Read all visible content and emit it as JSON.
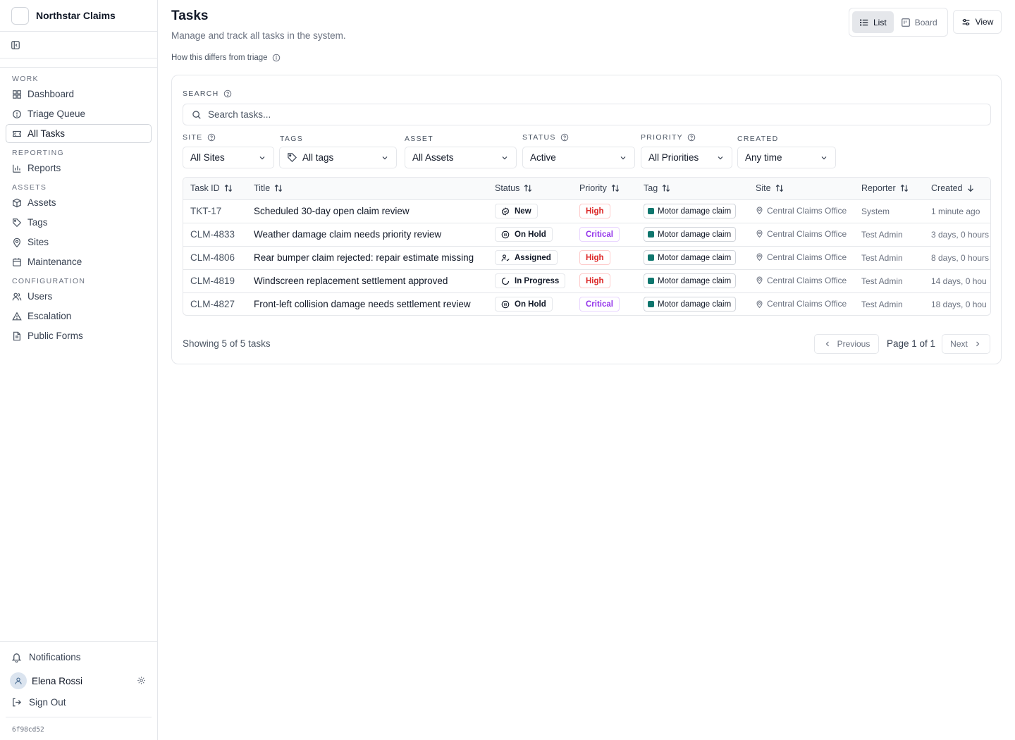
{
  "app": {
    "name": "Northstar Claims",
    "build": "6f98cd52"
  },
  "sidebar": {
    "sections": [
      {
        "label": "WORK",
        "items": [
          {
            "label": "Dashboard",
            "icon": "dashboard-icon"
          },
          {
            "label": "Triage Queue",
            "icon": "alert-circle-icon"
          },
          {
            "label": "All Tasks",
            "icon": "ticket-icon",
            "active": true
          }
        ]
      },
      {
        "label": "REPORTING",
        "items": [
          {
            "label": "Reports",
            "icon": "bar-chart-icon"
          }
        ]
      },
      {
        "label": "ASSETS",
        "items": [
          {
            "label": "Assets",
            "icon": "box-icon"
          },
          {
            "label": "Tags",
            "icon": "tag-icon"
          },
          {
            "label": "Sites",
            "icon": "map-pin-icon"
          },
          {
            "label": "Maintenance",
            "icon": "calendar-icon"
          }
        ]
      },
      {
        "label": "CONFIGURATION",
        "items": [
          {
            "label": "Users",
            "icon": "users-icon"
          },
          {
            "label": "Escalation",
            "icon": "warning-triangle-icon"
          },
          {
            "label": "Public Forms",
            "icon": "file-text-icon"
          }
        ]
      }
    ],
    "notifications_label": "Notifications",
    "user_name": "Elena Rossi",
    "sign_out_label": "Sign Out"
  },
  "header": {
    "title": "Tasks",
    "subtitle": "Manage and track all tasks in the system.",
    "help_link": "How this differs from triage",
    "view_list": "List",
    "view_board": "Board",
    "view_button": "View"
  },
  "filters": {
    "search_label": "SEARCH",
    "search_placeholder": "Search tasks...",
    "site_label": "SITE",
    "site_value": "All Sites",
    "tags_label": "TAGS",
    "tags_value": "All tags",
    "asset_label": "ASSET",
    "asset_value": "All Assets",
    "status_label": "STATUS",
    "status_value": "Active",
    "priority_label": "PRIORITY",
    "priority_value": "All Priorities",
    "created_label": "CREATED",
    "created_value": "Any time"
  },
  "table": {
    "columns": [
      "Task ID",
      "Title",
      "Status",
      "Priority",
      "Tag",
      "Site",
      "Reporter",
      "Created"
    ],
    "rows": [
      {
        "id": "TKT-17",
        "title": "Scheduled 30-day open claim review",
        "status": "New",
        "priority": "High",
        "tag": "Motor damage claim",
        "site": "Central Claims Office",
        "reporter": "System",
        "created": "1 minute ago"
      },
      {
        "id": "CLM-4833",
        "title": "Weather damage claim needs priority review",
        "status": "On Hold",
        "priority": "Critical",
        "tag": "Motor damage claim",
        "site": "Central Claims Office",
        "reporter": "Test Admin",
        "created": "3 days, 0 hours"
      },
      {
        "id": "CLM-4806",
        "title": "Rear bumper claim rejected: repair estimate missing",
        "status": "Assigned",
        "priority": "High",
        "tag": "Motor damage claim",
        "site": "Central Claims Office",
        "reporter": "Test Admin",
        "created": "8 days, 0 hours"
      },
      {
        "id": "CLM-4819",
        "title": "Windscreen replacement settlement approved",
        "status": "In Progress",
        "priority": "High",
        "tag": "Motor damage claim",
        "site": "Central Claims Office",
        "reporter": "Test Admin",
        "created": "14 days, 0 hou"
      },
      {
        "id": "CLM-4827",
        "title": "Front-left collision damage needs settlement review",
        "status": "On Hold",
        "priority": "Critical",
        "tag": "Motor damage claim",
        "site": "Central Claims Office",
        "reporter": "Test Admin",
        "created": "18 days, 0 hou"
      }
    ],
    "tag_color": "#0f766e"
  },
  "footer": {
    "count_text": "Showing 5 of 5 tasks",
    "previous_label": "Previous",
    "page_info": "Page 1 of 1",
    "next_label": "Next"
  },
  "colors": {
    "high": "#dc2626",
    "critical": "#9333ea",
    "border": "#e5e7eb"
  }
}
